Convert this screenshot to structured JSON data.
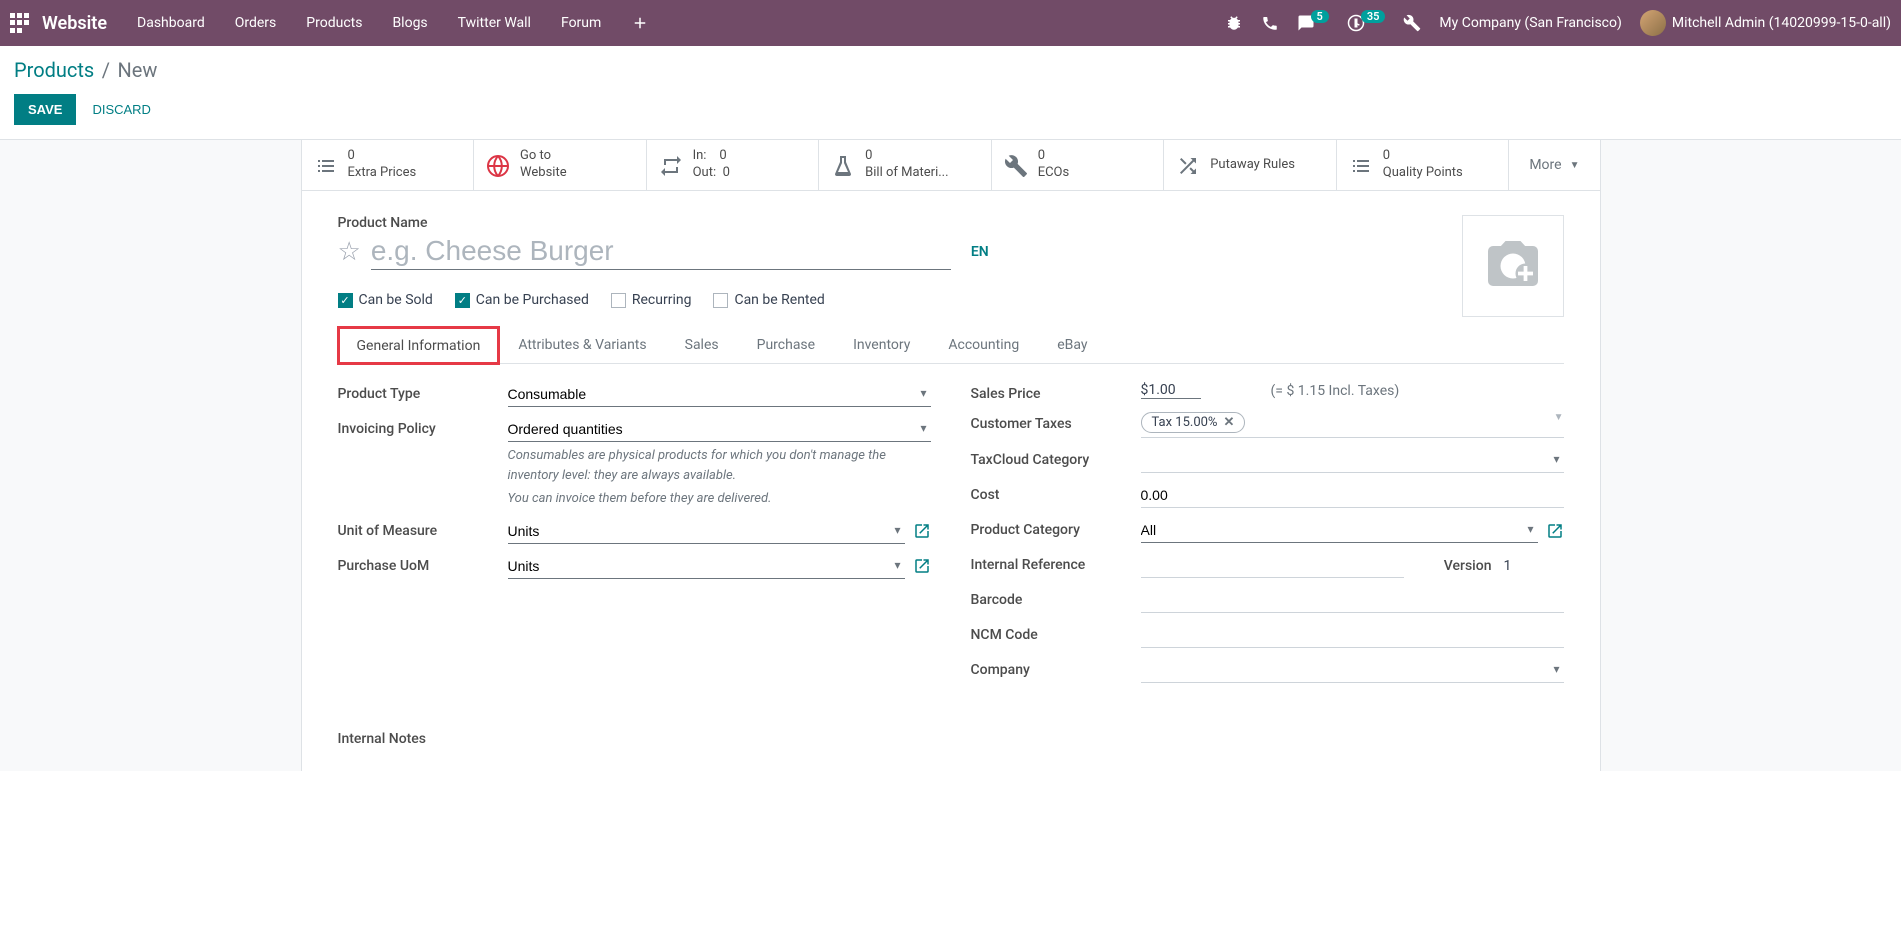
{
  "topbar": {
    "brand": "Website",
    "nav": [
      "Dashboard",
      "Orders",
      "Products",
      "Blogs",
      "Twitter Wall",
      "Forum"
    ],
    "messages_badge": "5",
    "activities_badge": "35",
    "company": "My Company (San Francisco)",
    "user": "Mitchell Admin (14020999-15-0-all)"
  },
  "breadcrumb": {
    "parent": "Products",
    "current": "New"
  },
  "actions": {
    "save": "SAVE",
    "discard": "DISCARD"
  },
  "stat_buttons": {
    "extra_prices": {
      "label": "Extra Prices",
      "value": "0"
    },
    "goto_website": {
      "line1": "Go to",
      "line2": "Website"
    },
    "inout": {
      "in_label": "In:",
      "in_value": "0",
      "out_label": "Out:",
      "out_value": "0"
    },
    "bom": {
      "label": "Bill of Materi...",
      "value": "0"
    },
    "ecos": {
      "label": "ECOs",
      "value": "0"
    },
    "putaway": {
      "label": "Putaway Rules"
    },
    "quality": {
      "label": "Quality Points",
      "value": "0"
    },
    "more": "More"
  },
  "product": {
    "name_label": "Product Name",
    "name_placeholder": "e.g. Cheese Burger",
    "lang": "EN",
    "can_sold": "Can be Sold",
    "can_purch": "Can be Purchased",
    "recurring": "Recurring",
    "can_rented": "Can be Rented"
  },
  "tabs": [
    "General Information",
    "Attributes & Variants",
    "Sales",
    "Purchase",
    "Inventory",
    "Accounting",
    "eBay"
  ],
  "fields": {
    "product_type": {
      "label": "Product Type",
      "value": "Consumable"
    },
    "invoicing_policy": {
      "label": "Invoicing Policy",
      "value": "Ordered quantities"
    },
    "help_consumable": "Consumables are physical products for which you don't manage the inventory level: they are always available.",
    "help_invoice": "You can invoice them before they are delivered.",
    "uom": {
      "label": "Unit of Measure",
      "value": "Units"
    },
    "purchase_uom": {
      "label": "Purchase UoM",
      "value": "Units"
    },
    "sales_price": {
      "label": "Sales Price",
      "value": "$1.00",
      "note": "(= $ 1.15 Incl. Taxes)"
    },
    "customer_taxes": {
      "label": "Customer Taxes",
      "tag": "Tax 15.00%"
    },
    "taxcloud": {
      "label": "TaxCloud Category"
    },
    "cost": {
      "label": "Cost",
      "value": "0.00"
    },
    "product_category": {
      "label": "Product Category",
      "value": "All"
    },
    "internal_ref": {
      "label": "Internal Reference"
    },
    "version": {
      "label": "Version",
      "value": "1"
    },
    "barcode": {
      "label": "Barcode"
    },
    "ncm": {
      "label": "NCM Code"
    },
    "company": {
      "label": "Company"
    },
    "internal_notes": "Internal Notes"
  }
}
